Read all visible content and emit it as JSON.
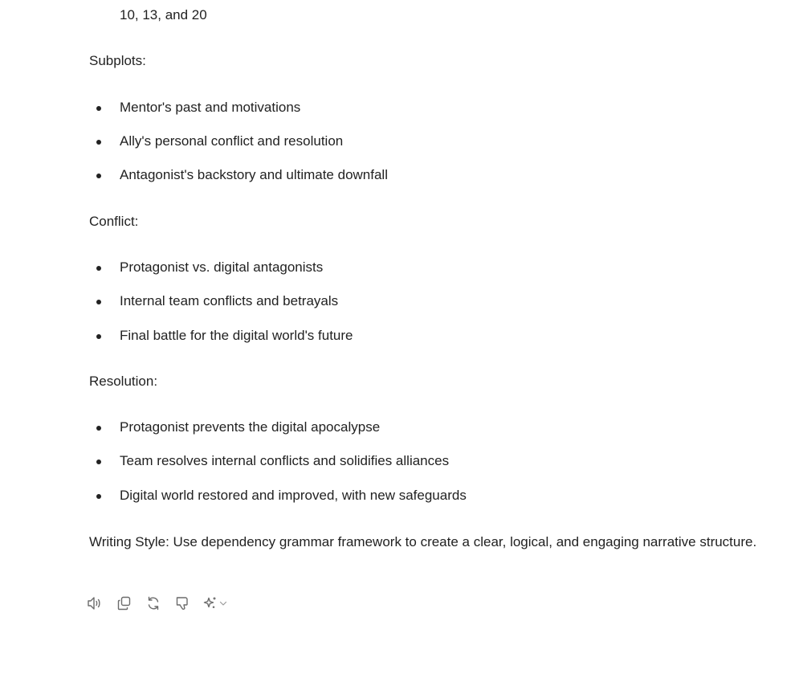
{
  "message": {
    "continuation_line": "10, 13, and 20",
    "sections": [
      {
        "heading": "Subplots:",
        "items": [
          "Mentor's past and motivations",
          "Ally's personal conflict and resolution",
          "Antagonist's backstory and ultimate downfall"
        ]
      },
      {
        "heading": "Conflict:",
        "items": [
          "Protagonist vs. digital antagonists",
          "Internal team conflicts and betrayals",
          "Final battle for the digital world's future"
        ]
      },
      {
        "heading": "Resolution:",
        "items": [
          "Protagonist prevents the digital apocalypse",
          "Team resolves internal conflicts and solidifies alliances",
          "Digital world restored and improved, with new safeguards"
        ]
      }
    ],
    "closing_paragraph": "Writing Style: Use dependency grammar framework to create a clear, logical, and engaging narrative structure."
  },
  "actions": {
    "icons": [
      "speaker-icon",
      "copy-icon",
      "regenerate-icon",
      "thumbs-down-icon",
      "sparkle-icon",
      "chevron-down-icon"
    ],
    "icon_color": "#6b6b6b"
  }
}
